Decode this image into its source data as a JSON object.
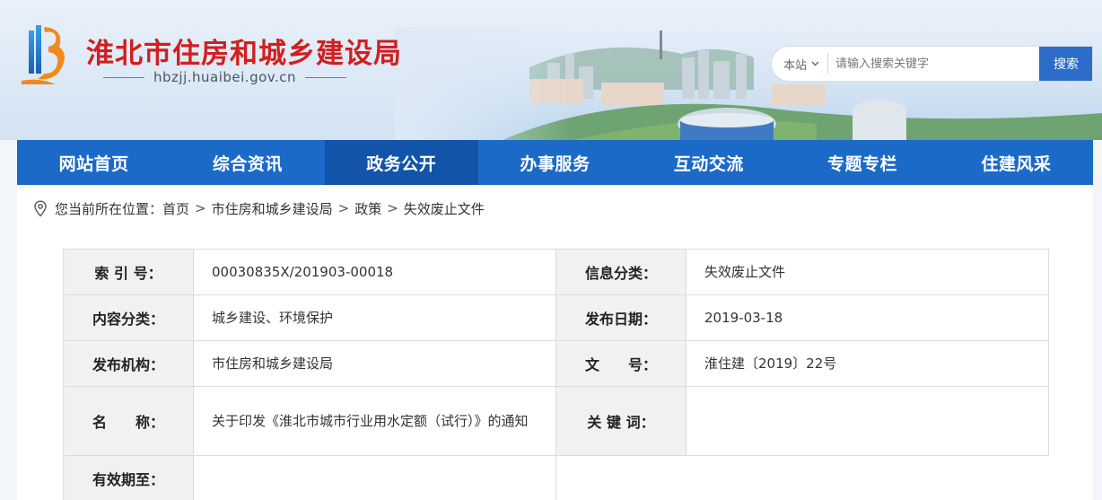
{
  "header": {
    "site_title": "淮北市住房和城乡建设局",
    "site_url": "hbzjj.huaibei.gov.cn",
    "colors": {
      "title_red": "#d11f1f",
      "nav_blue": "#1c6ac8",
      "nav_active": "#1254a9",
      "search_button": "#2b6dc9"
    },
    "search": {
      "scope": "本站",
      "placeholder": "请输入搜索关键字",
      "button_label": "搜索"
    }
  },
  "nav": {
    "items": [
      {
        "label": "网站首页"
      },
      {
        "label": "综合资讯"
      },
      {
        "label": "政务公开",
        "active": true
      },
      {
        "label": "办事服务"
      },
      {
        "label": "互动交流"
      },
      {
        "label": "专题专栏"
      },
      {
        "label": "住建风采"
      }
    ]
  },
  "breadcrumb": {
    "icon": "location-pin-icon",
    "prefix": "您当前所在位置：",
    "items": [
      "首页",
      "市住房和城乡建设局",
      "政策",
      "失效废止文件"
    ]
  },
  "info": {
    "index_label": "索 引 号：",
    "index_value": "00030835X/201903-00018",
    "category_label": "信息分类：",
    "category_value": "失效废止文件",
    "content_type_label": "内容分类：",
    "content_type_value": "城乡建设、环境保护",
    "publish_date_label": "发布日期：",
    "publish_date_value": "2019-03-18",
    "agency_label": "发布机构：",
    "agency_value": "市住房和城乡建设局",
    "doc_no_label": "文　　号：",
    "doc_no_value": "淮住建〔2019〕22号",
    "name_label": "名　　称：",
    "name_value": "关于印发《淮北市城市行业用水定额（试行）》的通知",
    "keywords_label": "关 键 词：",
    "keywords_value": "",
    "validity_label": "有效期至：",
    "validity_value": ""
  }
}
